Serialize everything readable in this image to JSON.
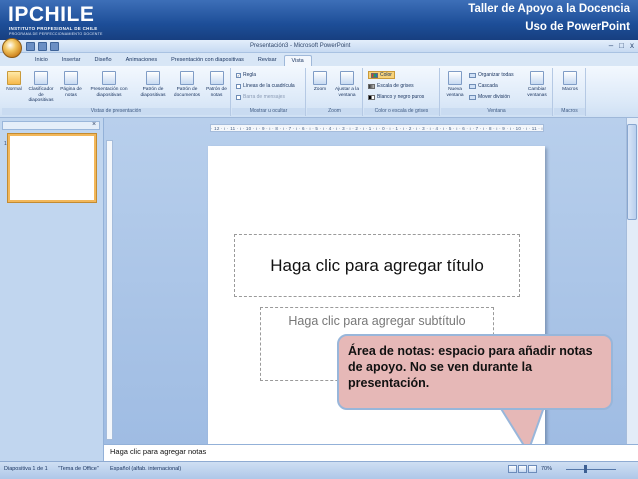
{
  "header": {
    "logo": "IPCHILE",
    "logo_sub1": "INSTITUTO PROFESIONAL DE CHILE",
    "logo_sub2": "PROGRAMA DE PERFECCIONAMIENTO DOCENTE",
    "line1": "Taller de Apoyo a la Docencia",
    "line2": "Uso de PowerPoint",
    "color": "#1d4e98"
  },
  "window": {
    "title": "Presentación3 - Microsoft PowerPoint",
    "controls": [
      "–",
      "□",
      "x"
    ]
  },
  "tabs": [
    {
      "label": "Inicio"
    },
    {
      "label": "Insertar"
    },
    {
      "label": "Diseño"
    },
    {
      "label": "Animaciones"
    },
    {
      "label": "Presentación con diapositivas"
    },
    {
      "label": "Revisar"
    },
    {
      "label": "Vista",
      "active": true
    }
  ],
  "ribbon": {
    "groups": {
      "vistas": "Vistas de presentación",
      "mostrar": "Mostrar u ocultar",
      "zoom": "Zoom",
      "color": "Color o escala de grises",
      "ventana": "Ventana",
      "macros": "Macros"
    },
    "buttons": {
      "normal": "Normal",
      "clasificador": "Clasificador de diapositivas",
      "pagina_notas": "Página de notas",
      "presentacion": "Presentación con diapositivas",
      "patron_diap": "Patrón de diapositivas",
      "patron_docs": "Patrón de documentos",
      "patron_notas": "Patrón de notas",
      "regla": "Regla",
      "lineas": "Líneas de la cuadrícula",
      "barra": "Barra de mensajes",
      "zoom": "Zoom",
      "ajustar": "Ajustar a la ventana",
      "color": "Color",
      "escala": "Escala de grises",
      "blanco_negro": "Blanco y negro puros",
      "nueva_ventana": "Nueva ventana",
      "organizar": "Organizar todas",
      "cascada": "Cascada",
      "mover": "Mover división",
      "cambiar": "Cambiar ventanas",
      "macros": "Macros"
    }
  },
  "left_panel": {
    "slide_number": "1"
  },
  "ruler_text": "· 12 · ı · 11 · ı · 10 · ı · 9 · ı · 8 · ı · 7 · ı · 6 · ı · 5 · ı · 4 · ı · 3 · ı · 2 · ı · 1 · ı · 0 · ı · 1 · ı · 2 · ı · 3 · ı · 4 · ı · 5 · ı · 6 · ı · 7 · ı · 8 · ı · 9 · ı · 10 · ı · 11 · ı · 12 ·",
  "slide": {
    "title_placeholder": "Haga clic para agregar título",
    "subtitle_placeholder": "Haga clic para agregar subtítulo"
  },
  "callout": {
    "text": "Área de notas: espacio para añadir notas de apoyo. No se ven durante la presentación.",
    "color": "#e6b8b7"
  },
  "notes": {
    "placeholder": "Haga clic para agregar notas"
  },
  "status": {
    "slide": "Diapositiva 1 de 1",
    "theme": "\"Tema de Office\"",
    "language": "Español (alfab. internacional)",
    "zoom": "70%"
  }
}
